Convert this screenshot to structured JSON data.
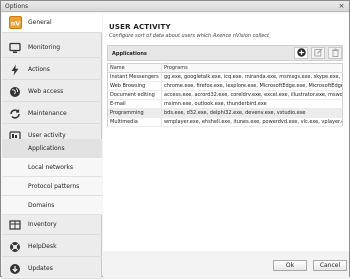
{
  "window": {
    "title": "Options",
    "close_glyph": "×"
  },
  "sidebar": {
    "items": [
      {
        "label": "General",
        "icon": "nv-logo-icon"
      },
      {
        "label": "Monitoring",
        "icon": "monitor-icon"
      },
      {
        "label": "Actions",
        "icon": "lightning-icon"
      },
      {
        "label": "Web access",
        "icon": "globe-icon"
      },
      {
        "label": "Maintenance",
        "icon": "maintenance-icon"
      },
      {
        "label": "User activity",
        "icon": "user-activity-icon"
      },
      {
        "label": "Inventory",
        "icon": "inventory-icon"
      },
      {
        "label": "HelpDesk",
        "icon": "helpdesk-icon"
      },
      {
        "label": "Updates",
        "icon": "updates-icon"
      }
    ],
    "subitems": [
      {
        "label": "Applications"
      },
      {
        "label": "Local networks"
      },
      {
        "label": "Protocol patterns"
      },
      {
        "label": "Domains"
      }
    ]
  },
  "content": {
    "section_title": "USER ACTIVITY",
    "section_desc": "Configure sort of data about users which Axence nVision collect",
    "apps_label": "Applications",
    "table": {
      "headers": [
        "Name",
        "Programs"
      ],
      "rows": [
        {
          "name": "Instant Messengers",
          "programs": "gg.exe, googletalk.exe, icq.exe, miranda.exe, msmsgs.exe, skype.exe, tlen.exe"
        },
        {
          "name": "Web Browsing",
          "programs": "chrome.exe, firefox.exe, iexplore.exe, MicrosoftEdge.exe, MicrosoftEdgeCP.exe"
        },
        {
          "name": "Document editing",
          "programs": "access.exe, acrord32.exe, coreldrv.exe, excel.exe, illustrator.exe, msworks.exe"
        },
        {
          "name": "E-mail",
          "programs": "msimn.exe, outlook.exe, thunderbird.exe"
        },
        {
          "name": "Programming",
          "programs": "bds.exe, d32.exe, delphi32.exe, devenv.exe, vstudio.exe"
        },
        {
          "name": "Multimedia",
          "programs": "wmplayer.exe, ehshell.exe, itunes.exe, powerdvd.exe, vlc.exe, vplayer.exe, winamp"
        }
      ]
    }
  },
  "footer": {
    "ok": "Ok",
    "cancel": "Cancel"
  },
  "colors": {
    "accent_orange": "#f0a030",
    "add_button": "#2b2b2b"
  }
}
